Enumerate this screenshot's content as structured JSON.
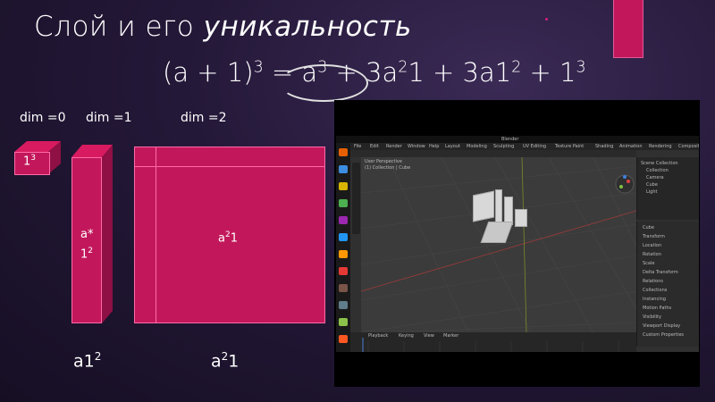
{
  "slide": {
    "title_plain": "Слой и его",
    "title_italic": "уникальность",
    "formula": {
      "p1": "(a + 1)",
      "e1": "3",
      "p2": " = a",
      "e2": "3",
      "p3": " + 3a",
      "e3": "2",
      "p4": "1 + 3a1",
      "e4": "2",
      "p5": " + 1",
      "e5": "3"
    },
    "dims": [
      "dim =0",
      "dim  =1",
      "dim  =2"
    ],
    "cube": {
      "base": "1",
      "exp": "3"
    },
    "column": {
      "line1": "a*",
      "base": "1",
      "exp": "2"
    },
    "square": {
      "base": "a",
      "exp": "2",
      "tail": "1"
    },
    "bottom": {
      "left": {
        "base": "a1",
        "exp": "2"
      },
      "right": {
        "base": "a",
        "exp": "2",
        "tail": "1"
      }
    },
    "accent_color": "#c2185b"
  },
  "blender": {
    "window_title": "Blender",
    "menu": [
      "File",
      "Edit",
      "Render",
      "Window",
      "Help",
      "Layout",
      "Modeling",
      "Sculpting",
      "UV Editing",
      "Texture Paint",
      "Shading",
      "Animation",
      "Rendering",
      "Compositing",
      "Scripting"
    ],
    "viewport_label": "User Perspective",
    "viewport_sub": "(1) Collection | Cube",
    "outliner": [
      "Scene Collection",
      "Collection",
      "Camera",
      "Cube",
      "Light"
    ],
    "props": [
      "Cube",
      "Transform",
      "Location",
      "Rotation",
      "Scale",
      "Delta Transform",
      "Relations",
      "Collections",
      "Instancing",
      "Motion Paths",
      "Visibility",
      "Viewport Display",
      "Custom Properties"
    ],
    "timeline": [
      "Playback",
      "Keying",
      "View",
      "Marker"
    ],
    "dock_colors": [
      "#e66000",
      "#3c8de0",
      "#d6b400",
      "#4caf50",
      "#9c27b0",
      "#2196f3",
      "#ff9800",
      "#e53935",
      "#795548",
      "#607d8b",
      "#8bc34a",
      "#ff5722"
    ]
  }
}
